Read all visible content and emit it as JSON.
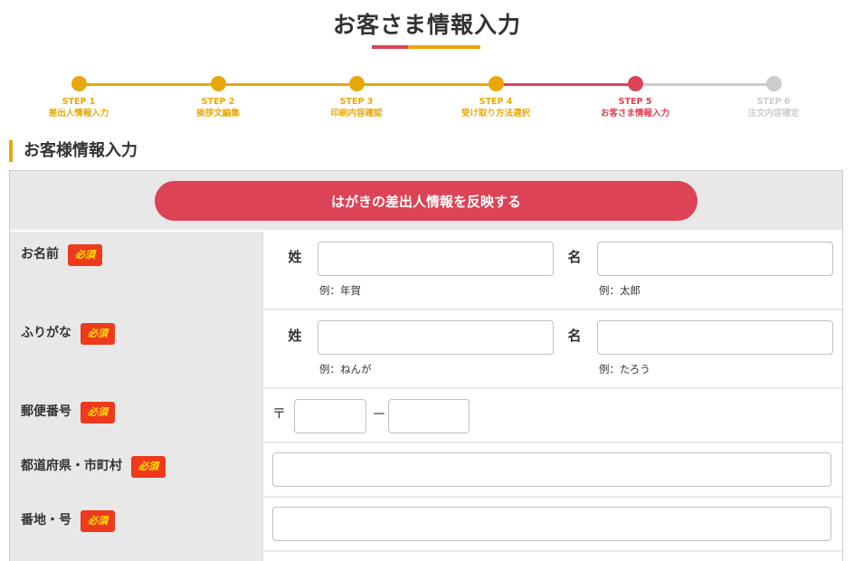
{
  "page": {
    "title": "お客さま情報入力"
  },
  "colors": {
    "accent_yellow": "#e8a80c",
    "accent_red": "#dc4356",
    "inactive_gray": "#cccccc",
    "required_badge_bg": "#ee3a1c",
    "required_badge_text": "#ffe400"
  },
  "steps": [
    {
      "step": "STEP 1",
      "label": "差出人情報入力",
      "status": "done"
    },
    {
      "step": "STEP 2",
      "label": "挨拶文編集",
      "status": "done"
    },
    {
      "step": "STEP 3",
      "label": "印刷内容確認",
      "status": "done"
    },
    {
      "step": "STEP 4",
      "label": "受け取り方法選択",
      "status": "done"
    },
    {
      "step": "STEP 5",
      "label": "お客さま情報入力",
      "status": "current"
    },
    {
      "step": "STEP 6",
      "label": "注文内容確定",
      "status": "pending"
    }
  ],
  "section": {
    "heading": "お客様情報入力"
  },
  "form": {
    "reflect_button": "はがきの差出人情報を反映する",
    "required_label": "必須",
    "name": {
      "label": "お名前",
      "last_label": "姓",
      "first_label": "名",
      "last_value": "",
      "first_value": "",
      "last_hint": "例：年賀",
      "first_hint": "例：太郎"
    },
    "kana": {
      "label": "ふりがな",
      "last_label": "姓",
      "first_label": "名",
      "last_value": "",
      "first_value": "",
      "last_hint": "例：ねんが",
      "first_hint": "例：たろう"
    },
    "postal": {
      "label": "郵便番号",
      "mark": "〒",
      "dash": "－",
      "part1_value": "",
      "part2_value": ""
    },
    "prefecture": {
      "label": "都道府県・市町村",
      "value": ""
    },
    "address": {
      "label": "番地・号",
      "value": ""
    }
  }
}
